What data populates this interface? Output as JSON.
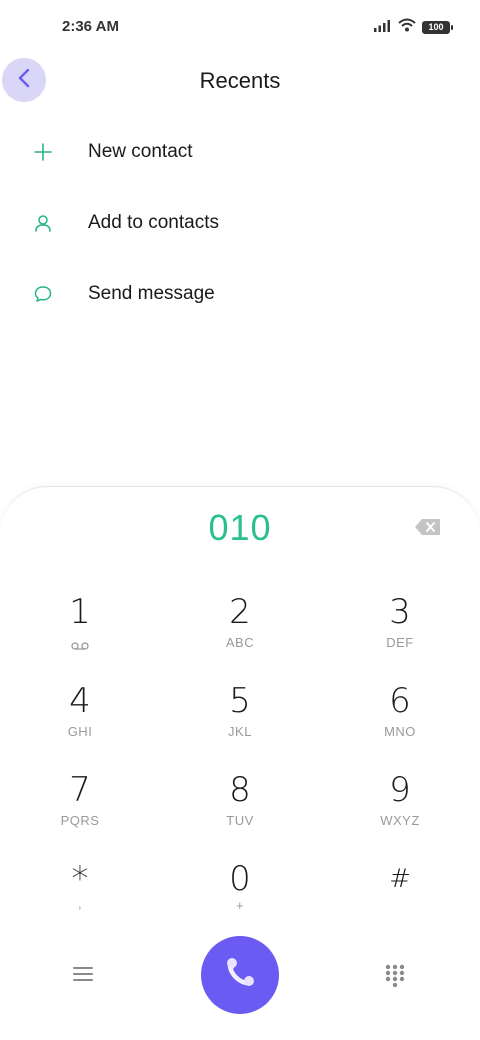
{
  "status_bar": {
    "time": "2:36 AM",
    "battery": "100",
    "icons": [
      "signal-icon",
      "wifi-icon",
      "battery-icon"
    ]
  },
  "header": {
    "title": "Recents",
    "back_icon": "back-arrow-icon"
  },
  "menu": [
    {
      "icon": "plus-icon",
      "label": "New contact"
    },
    {
      "icon": "person-icon",
      "label": "Add to contacts"
    },
    {
      "icon": "message-icon",
      "label": "Send message"
    }
  ],
  "dialer": {
    "number": "010",
    "keys": [
      {
        "digit": "1",
        "letters": ""
      },
      {
        "digit": "2",
        "letters": "ABC"
      },
      {
        "digit": "3",
        "letters": "DEF"
      },
      {
        "digit": "4",
        "letters": "GHI"
      },
      {
        "digit": "5",
        "letters": "JKL"
      },
      {
        "digit": "6",
        "letters": "MNO"
      },
      {
        "digit": "7",
        "letters": "PQRS"
      },
      {
        "digit": "8",
        "letters": "TUV"
      },
      {
        "digit": "9",
        "letters": "WXYZ"
      },
      {
        "digit": "*",
        "letters": ","
      },
      {
        "digit": "0",
        "letters": "+"
      },
      {
        "digit": "#",
        "letters": ""
      }
    ]
  },
  "colors": {
    "accent": "#6a5cf2",
    "number_green": "#2ac08a",
    "icon_green": "#2ab48a",
    "back_bg": "#d9d6f7"
  }
}
